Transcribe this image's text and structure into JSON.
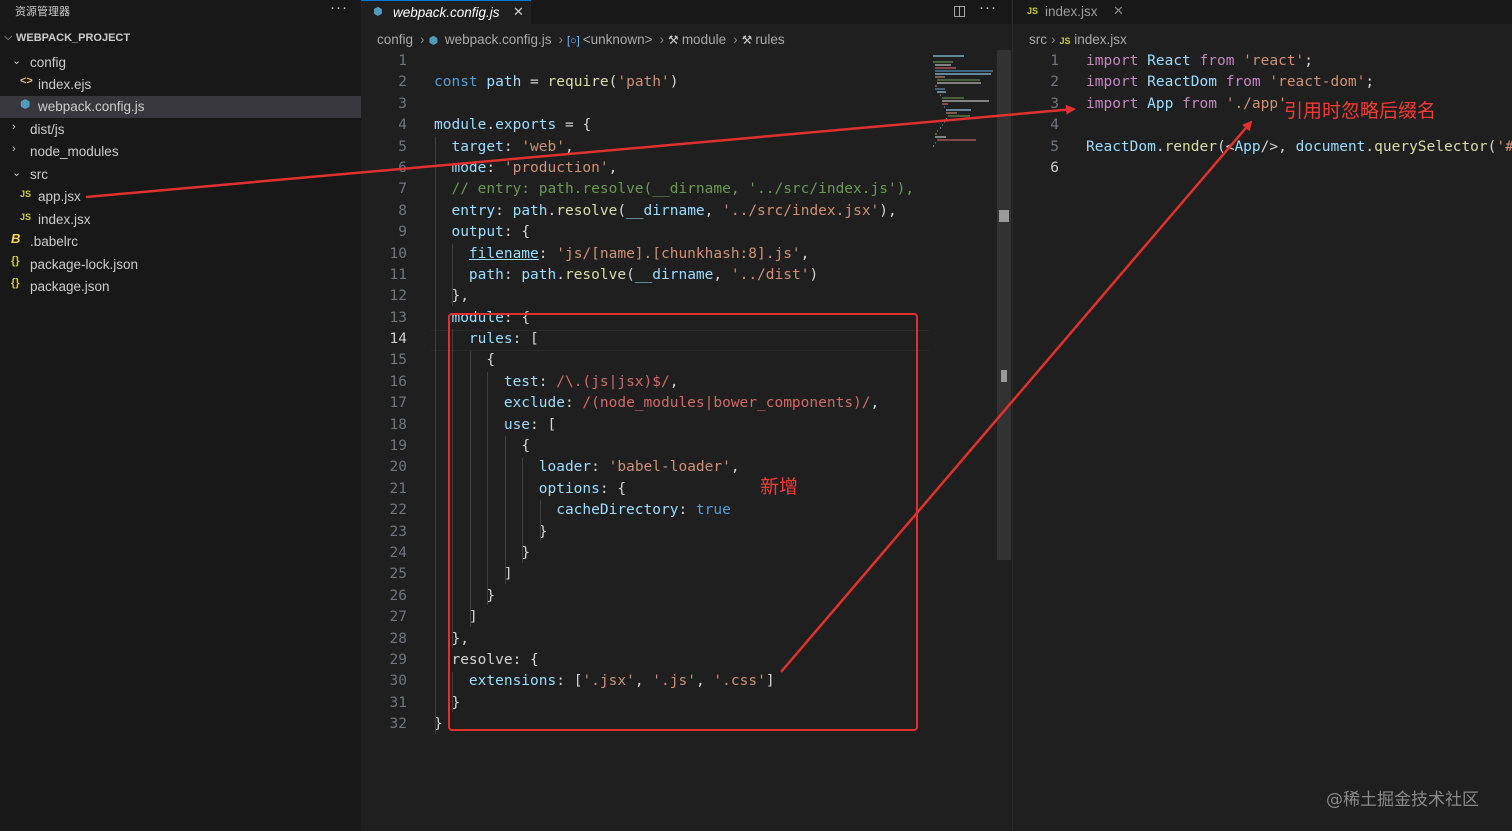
{
  "sidebar": {
    "title": "资源管理器",
    "more": "···",
    "project": "WEBPACK_PROJECT",
    "items": [
      {
        "label": "config",
        "type": "folder",
        "expanded": true
      },
      {
        "label": "index.ejs",
        "type": "ejs"
      },
      {
        "label": "webpack.config.js",
        "type": "config",
        "selected": true
      },
      {
        "label": "dist/js",
        "type": "folder",
        "expanded": false
      },
      {
        "label": "node_modules",
        "type": "folder",
        "expanded": false
      },
      {
        "label": "src",
        "type": "folder",
        "expanded": true
      },
      {
        "label": "app.jsx",
        "type": "js",
        "icon": "JS"
      },
      {
        "label": "index.jsx",
        "type": "js",
        "icon": "JS"
      },
      {
        "label": ".babelrc",
        "type": "babel"
      },
      {
        "label": "package-lock.json",
        "type": "json",
        "icon": "{}"
      },
      {
        "label": "package.json",
        "type": "json",
        "icon": "{}"
      }
    ]
  },
  "editor1": {
    "tab": {
      "label": "webpack.config.js",
      "close": "✕"
    },
    "more": "···",
    "breadcrumb": [
      "config",
      "webpack.config.js",
      "<unknown>",
      "module",
      "rules"
    ],
    "active_line": 14,
    "lines": [
      "",
      "const path = require('path')",
      "",
      "module.exports = {",
      "  target: 'web',",
      "  mode: 'production',",
      "  // entry: path.resolve(__dirname, '../src/index.js'),",
      "  entry: path.resolve(__dirname, '../src/index.jsx'),",
      "  output: {",
      "    filename: 'js/[name].[chunkhash:8].js',",
      "    path: path.resolve(__dirname, '../dist')",
      "  },",
      "  module: {",
      "    rules: [",
      "      {",
      "        test: /\\.(js|jsx)$/,",
      "        exclude: /(node_modules|bower_components)/,",
      "        use: [",
      "          {",
      "            loader: 'babel-loader',",
      "            options: {",
      "              cacheDirectory: true",
      "            }",
      "          }",
      "        ]",
      "      }",
      "    ]",
      "  },",
      "  resolve: {",
      "    extensions: ['.jsx', '.js', '.css']",
      "  }",
      "}"
    ]
  },
  "editor2": {
    "tab": {
      "label": "index.jsx",
      "icon": "JS",
      "close": "✕"
    },
    "breadcrumb": [
      "src",
      "index.jsx"
    ],
    "active_line": 6,
    "lines": [
      "import React from 'react';",
      "import ReactDom from 'react-dom';",
      "import App from './app'",
      "",
      "ReactDom.render(<App/>, document.querySelector('#r",
      ""
    ]
  },
  "annotations": {
    "new_label": "新增",
    "ext_label": "引用时忽略后缀名",
    "color": "#e0312e"
  },
  "watermark": "@稀土掘金技术社区",
  "colors": {
    "keyword": "#569cd6",
    "control": "#c586c0",
    "variable": "#9cdcfe",
    "function": "#dcdcaa",
    "string": "#ce9178",
    "regex": "#d16969",
    "comment": "#6a9955",
    "accent": "#0078d4"
  }
}
